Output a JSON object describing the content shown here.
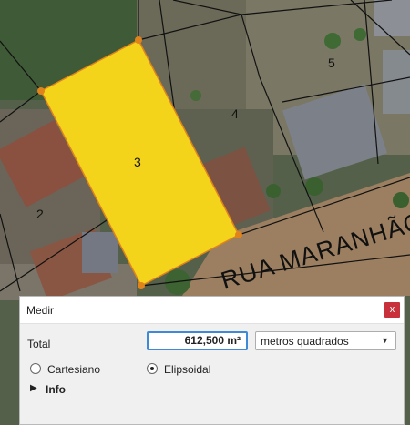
{
  "map": {
    "street_name": "RUA MARANHÃO",
    "parcels": {
      "p2": "2",
      "p3": "3",
      "p4": "4",
      "p5": "5"
    },
    "highlight_fill": "#f3d41a",
    "highlight_stroke": "#e0831a",
    "parcel_line_color": "#111111"
  },
  "dialog": {
    "title": "Medir",
    "close_label": "x",
    "total_label": "Total",
    "total_value": "612,500 m²",
    "unit_selected": "metros quadrados",
    "radio_cartesiano": "Cartesiano",
    "radio_elipsoidal": "Elipsoidal",
    "selected_mode": "Elipsoidal",
    "info_label": "Info",
    "accent_color": "#3e8ad6",
    "close_color": "#c8313b"
  }
}
